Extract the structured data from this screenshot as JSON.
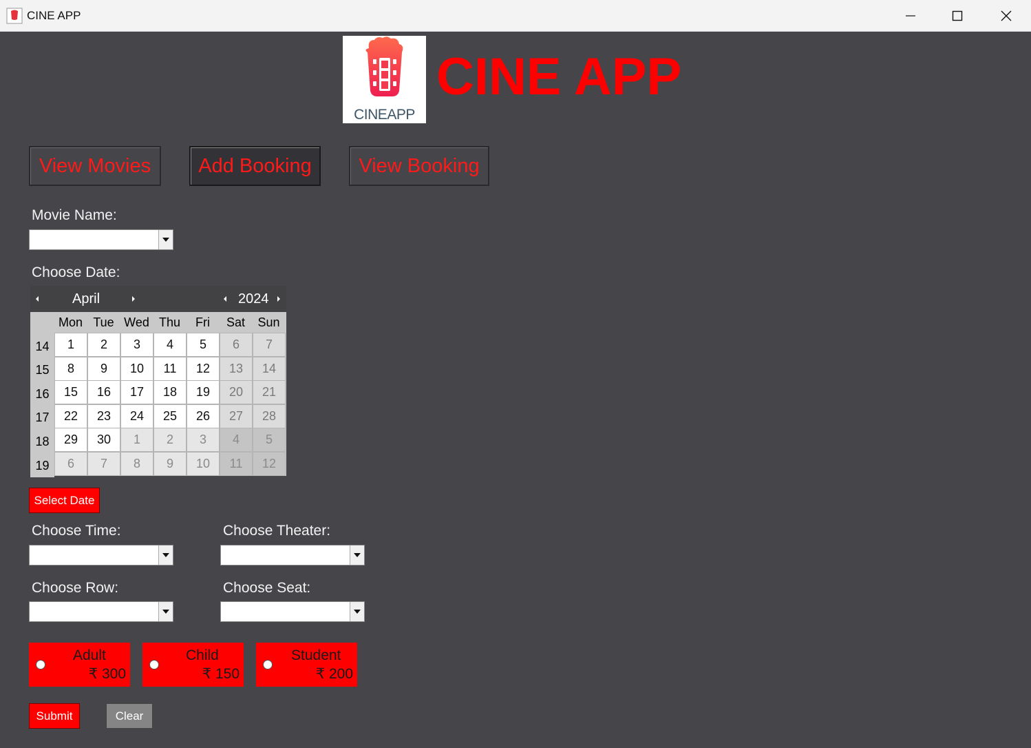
{
  "window": {
    "title": "CINE APP"
  },
  "header": {
    "logo_text_a": "CINE",
    "logo_text_b": "APP",
    "heading": "CINE APP"
  },
  "nav": [
    {
      "label": "View Movies",
      "active": false
    },
    {
      "label": "Add Booking",
      "active": true
    },
    {
      "label": "View Booking",
      "active": false
    }
  ],
  "form": {
    "movie_label": "Movie Name:",
    "date_label": "Choose Date:",
    "select_date": "Select Date",
    "time_label": "Choose Time:",
    "theater_label": "Choose Theater:",
    "row_label": "Choose Row:",
    "seat_label": "Choose Seat:",
    "submit": "Submit",
    "clear": "Clear"
  },
  "calendar": {
    "month": "April",
    "year": "2024",
    "weekdays": [
      "Mon",
      "Tue",
      "Wed",
      "Thu",
      "Fri",
      "Sat",
      "Sun"
    ],
    "weeks": [
      {
        "num": "14",
        "days": [
          "1",
          "2",
          "3",
          "4",
          "5",
          "6",
          "7"
        ],
        "other": [
          false,
          false,
          false,
          false,
          false,
          false,
          false
        ]
      },
      {
        "num": "15",
        "days": [
          "8",
          "9",
          "10",
          "11",
          "12",
          "13",
          "14"
        ],
        "other": [
          false,
          false,
          false,
          false,
          false,
          false,
          false
        ]
      },
      {
        "num": "16",
        "days": [
          "15",
          "16",
          "17",
          "18",
          "19",
          "20",
          "21"
        ],
        "other": [
          false,
          false,
          false,
          false,
          false,
          false,
          false
        ]
      },
      {
        "num": "17",
        "days": [
          "22",
          "23",
          "24",
          "25",
          "26",
          "27",
          "28"
        ],
        "other": [
          false,
          false,
          false,
          false,
          false,
          false,
          false
        ]
      },
      {
        "num": "18",
        "days": [
          "29",
          "30",
          "1",
          "2",
          "3",
          "4",
          "5"
        ],
        "other": [
          false,
          false,
          true,
          true,
          true,
          true,
          true
        ]
      },
      {
        "num": "19",
        "days": [
          "6",
          "7",
          "8",
          "9",
          "10",
          "11",
          "12"
        ],
        "other": [
          true,
          true,
          true,
          true,
          true,
          true,
          true
        ]
      }
    ]
  },
  "tickets": [
    {
      "name": "Adult",
      "price": "₹ 300"
    },
    {
      "name": "Child",
      "price": "₹ 150"
    },
    {
      "name": "Student",
      "price": "₹ 200"
    }
  ],
  "colors": {
    "accent": "#ff0000",
    "background": "#46454a"
  }
}
